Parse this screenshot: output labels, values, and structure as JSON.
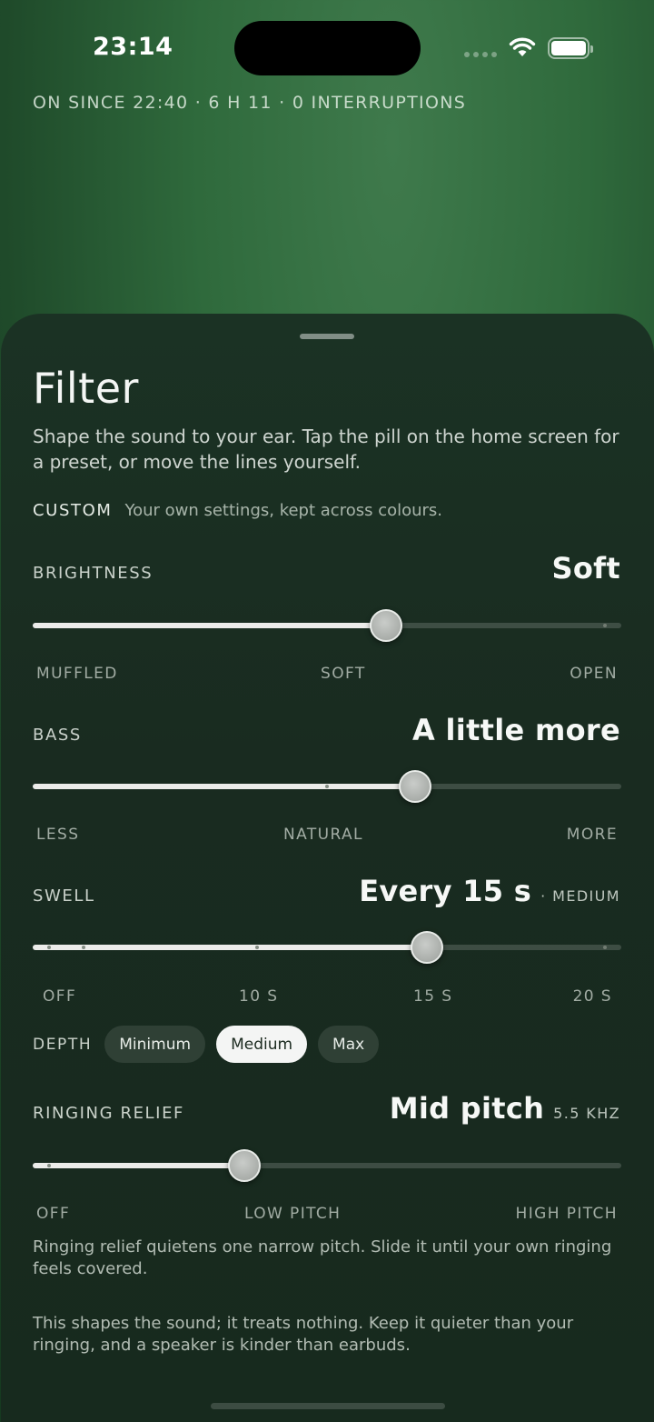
{
  "status_bar": {
    "time": "23:14",
    "icons": [
      "signal-dots-icon",
      "wifi-icon",
      "battery-icon"
    ]
  },
  "session_text": "ON SINCE 22:40 · 6 H 11 · 0 INTERRUPTIONS",
  "sheet": {
    "title": "Filter",
    "description": "Shape the sound to your ear. Tap the pill on the home screen for a preset, or move the lines yourself.",
    "custom_label": "CUSTOM",
    "custom_note": "Your own settings, kept across colours."
  },
  "brightness": {
    "label": "BRIGHTNESS",
    "value": "Soft",
    "level": 0.6,
    "scale": [
      "MUFFLED",
      "SOFT",
      "OPEN"
    ]
  },
  "bass": {
    "label": "BASS",
    "value": "A little more",
    "level": 0.65,
    "scale": [
      "LESS",
      "NATURAL",
      "MORE"
    ]
  },
  "swell": {
    "label": "SWELL",
    "value": "Every 15 s",
    "suffix": "· MEDIUM",
    "level": 0.67,
    "scale": [
      "OFF",
      "10 S",
      "15 S",
      "20 S"
    ]
  },
  "depth": {
    "label": "DEPTH",
    "options": [
      "Minimum",
      "Medium",
      "Max"
    ],
    "selected": "Medium"
  },
  "ringing_relief": {
    "label": "RINGING RELIEF",
    "value": "Mid pitch",
    "suffix": "5.5 KHZ",
    "level": 0.36,
    "scale": [
      "OFF",
      "LOW PITCH",
      "HIGH PITCH"
    ],
    "note": "Ringing relief quietens one narrow pitch. Slide it until your own ringing feels covered."
  },
  "disclaimer": "This shapes the sound; it treats nothing. Keep it quieter than your ringing, and a speaker is kinder than earbuds.",
  "colors": {
    "background": "#2f6a3c",
    "sheet": "#1a2e22",
    "accent": "#ececea"
  }
}
